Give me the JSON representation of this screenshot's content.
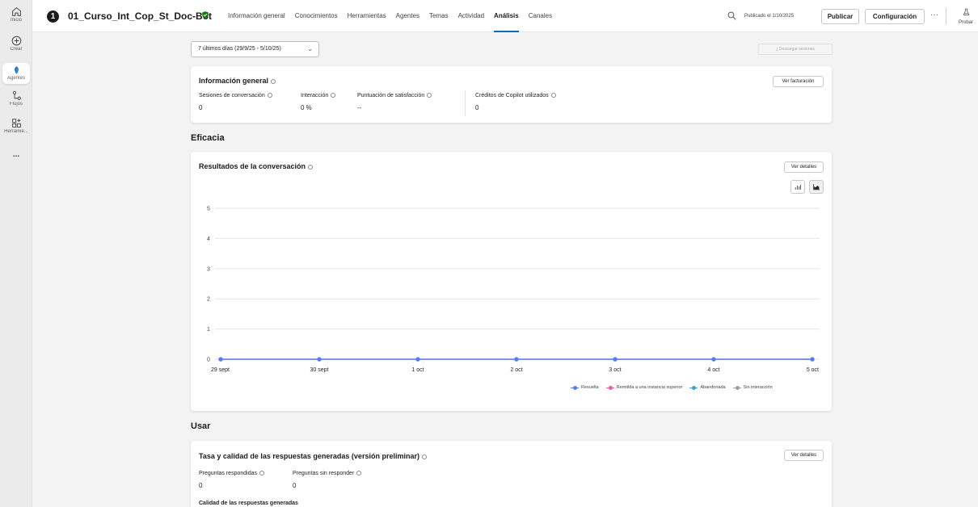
{
  "rail": {
    "items": [
      {
        "label": "Inicio",
        "icon": "home-icon"
      },
      {
        "label": "Crear",
        "icon": "plus-circle-icon"
      },
      {
        "label": "Agentes",
        "icon": "agents-icon"
      },
      {
        "label": "Flujos",
        "icon": "flows-icon"
      },
      {
        "label": "Herramie...",
        "icon": "tools-icon"
      }
    ],
    "more_label": "..."
  },
  "topbar": {
    "badge": "1",
    "agent_name": "01_Curso_Int_Cop_St_Doc-Bot",
    "tabs": [
      {
        "label": "Información general",
        "active": false
      },
      {
        "label": "Conocimientos",
        "active": false
      },
      {
        "label": "Herramientas",
        "active": false
      },
      {
        "label": "Agentes",
        "active": false
      },
      {
        "label": "Temas",
        "active": false
      },
      {
        "label": "Actividad",
        "active": false
      },
      {
        "label": "Análisis",
        "active": true
      },
      {
        "label": "Canales",
        "active": false
      }
    ],
    "published": "Publicado el 1/10/2025",
    "publish_button": "Publicar",
    "config_button": "Configuración",
    "more": "···",
    "test_label": "Probar"
  },
  "filters": {
    "date_range": "7 últimos días (29/9/25 - 5/10/25)",
    "download_button": "Descargar sesiones"
  },
  "overview": {
    "title": "Información general",
    "billing_button": "Ver facturación",
    "metrics": [
      {
        "label": "Sesiones de conversación",
        "value": "0"
      },
      {
        "label": "Interacción",
        "value": "0 %"
      },
      {
        "label": "Puntuación de satisfacción",
        "value": "--"
      },
      {
        "label": "Créditos de Copilot utilizados",
        "value": "0"
      }
    ]
  },
  "effectiveness": {
    "section_title": "Eficacia",
    "card_title": "Resultados de la conversación",
    "details_button": "Ver detalles"
  },
  "chart_data": {
    "type": "line",
    "x": [
      "29 sept",
      "30 sept",
      "1 oct",
      "2 oct",
      "3 oct",
      "4 oct",
      "5 oct"
    ],
    "ylim": [
      0,
      5
    ],
    "yticks": [
      0,
      1,
      2,
      3,
      4,
      5
    ],
    "grid": true,
    "legend_position": "bottom-right",
    "series": [
      {
        "name": "Resuelta",
        "color": "#4f7ff0",
        "values": [
          0,
          0,
          0,
          0,
          0,
          0,
          0
        ]
      },
      {
        "name": "Remitida a una instancia superior",
        "color": "#e35fa8",
        "values": [
          0,
          0,
          0,
          0,
          0,
          0,
          0
        ]
      },
      {
        "name": "Abandonada",
        "color": "#3fa0d8",
        "values": [
          0,
          0,
          0,
          0,
          0,
          0,
          0
        ]
      },
      {
        "name": "Sin interacción",
        "color": "#9e9e9e",
        "values": [
          0,
          0,
          0,
          0,
          0,
          0,
          0
        ]
      }
    ]
  },
  "usage": {
    "section_title": "Usar",
    "card_title": "Tasa y calidad de las respuestas generadas (versión preliminar)",
    "details_button": "Ver detalles",
    "metrics": [
      {
        "label": "Preguntas respondidas",
        "value": "0"
      },
      {
        "label": "Preguntas sin responder",
        "value": "0"
      }
    ],
    "quality_label": "Calidad de las respuestas generadas"
  }
}
